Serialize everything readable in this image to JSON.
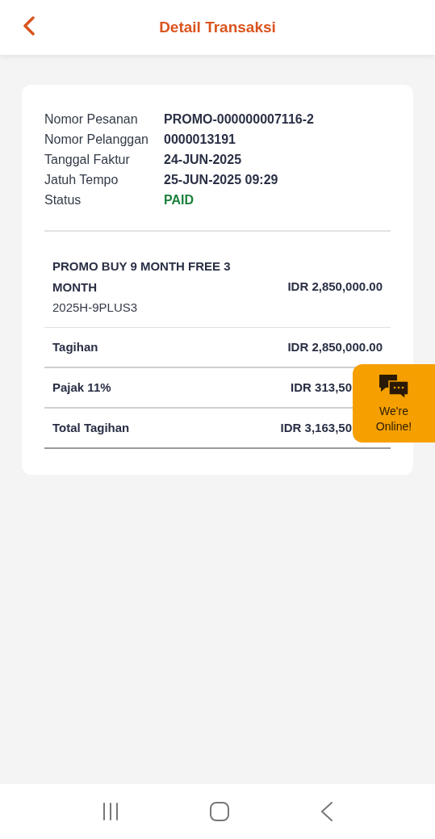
{
  "header": {
    "title": "Detail Transaksi"
  },
  "info": [
    {
      "label": "Nomor Pesanan",
      "value": "PROMO-000000007116-2",
      "kind": "plain"
    },
    {
      "label": "Nomor Pelanggan",
      "value": "0000013191",
      "kind": "plain"
    },
    {
      "label": "Tanggal Faktur",
      "value": "24-JUN-2025",
      "kind": "plain"
    },
    {
      "label": "Jatuh Tempo",
      "value": "25-JUN-2025 09:29",
      "kind": "plain"
    },
    {
      "label": "Status",
      "value": "PAID",
      "kind": "status"
    }
  ],
  "item": {
    "name": "PROMO BUY 9 MONTH FREE 3 MONTH",
    "code": "2025H-9PLUS3",
    "amount": "IDR 2,850,000.00"
  },
  "subtotal": {
    "label": "Tagihan",
    "amount": "IDR 2,850,000.00"
  },
  "totals": [
    {
      "label": "Pajak 11%",
      "amount": "IDR 313,50"
    },
    {
      "label": "Total Tagihan",
      "amount": "IDR 3,163,50"
    }
  ],
  "chat_widget": {
    "label": "We're Online!"
  }
}
